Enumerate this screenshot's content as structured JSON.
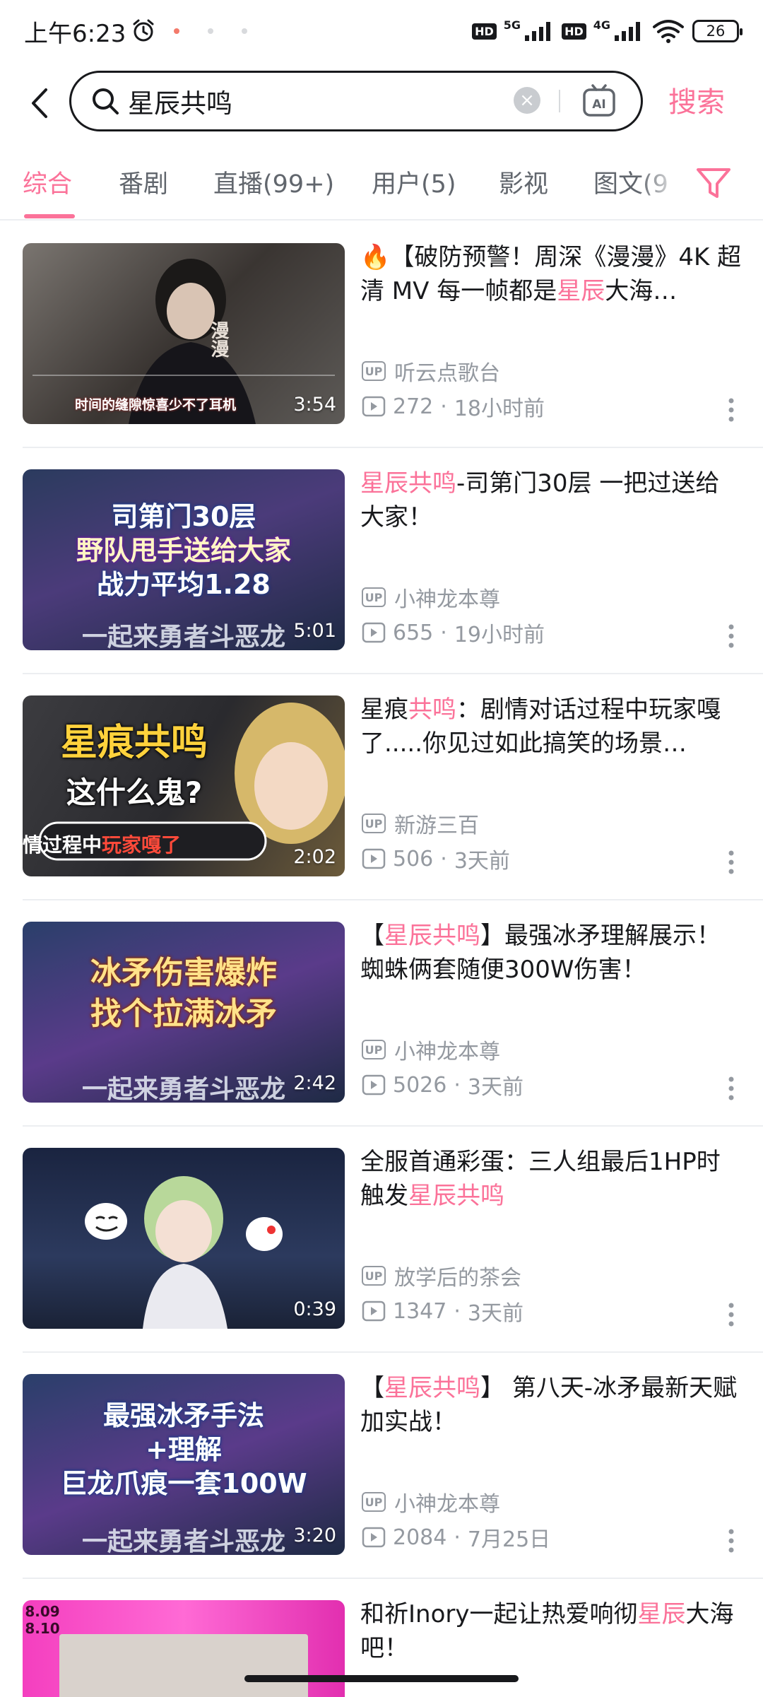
{
  "status_bar": {
    "time": "上午6:23",
    "hd1": "HD",
    "net1": "5G",
    "hd2": "HD",
    "net2": "4G",
    "battery": "26"
  },
  "search": {
    "query": "星辰共鸣",
    "submit_label": "搜索"
  },
  "tabs": [
    {
      "label": "综合"
    },
    {
      "label": "番剧"
    },
    {
      "label": "直播(99+)"
    },
    {
      "label": "用户(5)"
    },
    {
      "label": "影视"
    },
    {
      "label": "图文(9"
    }
  ],
  "colors": {
    "accent": "#fb7299",
    "text": "#18191c",
    "muted": "#9499a0"
  },
  "results": [
    {
      "title_parts": [
        {
          "t": "🔥【破防预警！周深《漫漫》4K 超清 MV 每一帧都是",
          "hl": false
        },
        {
          "t": "星辰",
          "hl": true
        },
        {
          "t": "大海…",
          "hl": false
        }
      ],
      "up": "听云点歌台",
      "plays": "272",
      "time": "18小时前",
      "duration": "3:54",
      "caption": "时间的缝隙惊喜少不了耳机",
      "overlay_text": "漫漫"
    },
    {
      "title_parts": [
        {
          "t": "星辰共鸣",
          "hl": true
        },
        {
          "t": "-司第门30层 一把过送给大家！",
          "hl": false
        }
      ],
      "up": "小神龙本尊",
      "plays": "655",
      "time": "19小时前",
      "duration": "5:01",
      "caption": "司第门30层",
      "caption2": "野队甩手送给大家",
      "caption3": "战力平均1.28",
      "banner": "一起来勇者斗恶龙"
    },
    {
      "title_parts": [
        {
          "t": "星痕",
          "hl": false
        },
        {
          "t": "共鸣",
          "hl": true
        },
        {
          "t": "：剧情对话过程中玩家嘎了.....你见过如此搞笑的场景…",
          "hl": false
        }
      ],
      "up": "新游三百",
      "plays": "506",
      "time": "3天前",
      "duration": "2:02",
      "caption": "星痕共鸣",
      "caption2": "这什么鬼?",
      "caption3": "剧情过程中",
      "caption3_hl": "玩家嘎了"
    },
    {
      "title_parts": [
        {
          "t": "【",
          "hl": false
        },
        {
          "t": "星辰共鸣",
          "hl": true
        },
        {
          "t": "】最强冰矛理解展示！蜘蛛俩套随便300W伤害！",
          "hl": false
        }
      ],
      "up": "小神龙本尊",
      "plays": "5026",
      "time": "3天前",
      "duration": "2:42",
      "caption": "冰矛伤害爆炸",
      "caption2": "找个拉满冰矛",
      "banner": "一起来勇者斗恶龙"
    },
    {
      "title_parts": [
        {
          "t": "全服首通彩蛋：三人组最后1HP时触发",
          "hl": false
        },
        {
          "t": "星辰共鸣",
          "hl": true
        }
      ],
      "up": "放学后的茶会",
      "plays": "1347",
      "time": "3天前",
      "duration": "0:39"
    },
    {
      "title_parts": [
        {
          "t": "【",
          "hl": false
        },
        {
          "t": "星辰共鸣",
          "hl": true
        },
        {
          "t": "】 第八天-冰矛最新天赋加实战！",
          "hl": false
        }
      ],
      "up": "小神龙本尊",
      "plays": "2084",
      "time": "7月25日",
      "duration": "3:20",
      "caption": "最强冰矛手法",
      "caption2": "+理解",
      "caption3": "巨龙爪痕一套100W",
      "banner": "一起来勇者斗恶龙"
    },
    {
      "title_parts": [
        {
          "t": "和祈Inory一起让热爱响彻",
          "hl": false
        },
        {
          "t": "星辰",
          "hl": true
        },
        {
          "t": "大海吧！",
          "hl": false
        }
      ],
      "thumb_text1": "8.09",
      "thumb_text2": "8.10"
    }
  ]
}
